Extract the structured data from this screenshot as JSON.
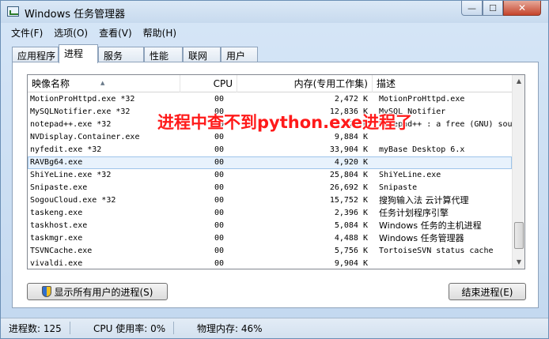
{
  "window": {
    "title": "Windows 任务管理器",
    "minimize_label": "—",
    "maximize_label": "☐",
    "close_label": "✕"
  },
  "menu": [
    "文件(F)",
    "选项(O)",
    "查看(V)",
    "帮助(H)"
  ],
  "tabs": [
    {
      "label": "应用程序"
    },
    {
      "label": "进程"
    },
    {
      "label": "服务"
    },
    {
      "label": "性能"
    },
    {
      "label": "联网"
    },
    {
      "label": "用户"
    }
  ],
  "active_tab": "进程",
  "columns": {
    "name": "映像名称",
    "cpu": "CPU",
    "mem": "内存(专用工作集)",
    "desc": "描述"
  },
  "processes": [
    {
      "name": "MotionProHttpd.exe *32",
      "cpu": "00",
      "mem": "2,472 K",
      "desc": "MotionProHttpd.exe"
    },
    {
      "name": "MySQLNotifier.exe *32",
      "cpu": "00",
      "mem": "12,836 K",
      "desc": "MySQL Notifier"
    },
    {
      "name": "notepad++.exe *32",
      "cpu": "00",
      "mem": "9,076 K",
      "desc": "Notepad++ : a free (GNU) sou"
    },
    {
      "name": "NVDisplay.Container.exe",
      "cpu": "00",
      "mem": "9,884 K",
      "desc": ""
    },
    {
      "name": "nyfedit.exe *32",
      "cpu": "00",
      "mem": "33,904 K",
      "desc": "myBase Desktop 6.x"
    },
    {
      "name": "RAVBg64.exe",
      "cpu": "00",
      "mem": "4,920 K",
      "desc": ""
    },
    {
      "name": "ShiYeLine.exe *32",
      "cpu": "00",
      "mem": "25,804 K",
      "desc": "ShiYeLine.exe"
    },
    {
      "name": "Snipaste.exe",
      "cpu": "00",
      "mem": "26,692 K",
      "desc": "Snipaste"
    },
    {
      "name": "SogouCloud.exe *32",
      "cpu": "00",
      "mem": "15,752 K",
      "desc": "搜狗输入法 云计算代理"
    },
    {
      "name": "taskeng.exe",
      "cpu": "00",
      "mem": "2,396 K",
      "desc": "任务计划程序引擎"
    },
    {
      "name": "taskhost.exe",
      "cpu": "00",
      "mem": "5,084 K",
      "desc": "Windows 任务的主机进程"
    },
    {
      "name": "taskmgr.exe",
      "cpu": "00",
      "mem": "4,488 K",
      "desc": "Windows 任务管理器"
    },
    {
      "name": "TSVNCache.exe",
      "cpu": "00",
      "mem": "5,756 K",
      "desc": "TortoiseSVN status cache"
    },
    {
      "name": "vivaldi.exe",
      "cpu": "00",
      "mem": "9,904 K",
      "desc": ""
    }
  ],
  "selected_process": "RAVBg64.exe",
  "annotation": "进程中查不到python.exe进程了",
  "buttons": {
    "show_all": "显示所有用户的进程(S)",
    "end_process": "结束进程(E)"
  },
  "status": {
    "processes": "进程数: 125",
    "cpu": "CPU 使用率: 0%",
    "memory": "物理内存: 46%"
  }
}
